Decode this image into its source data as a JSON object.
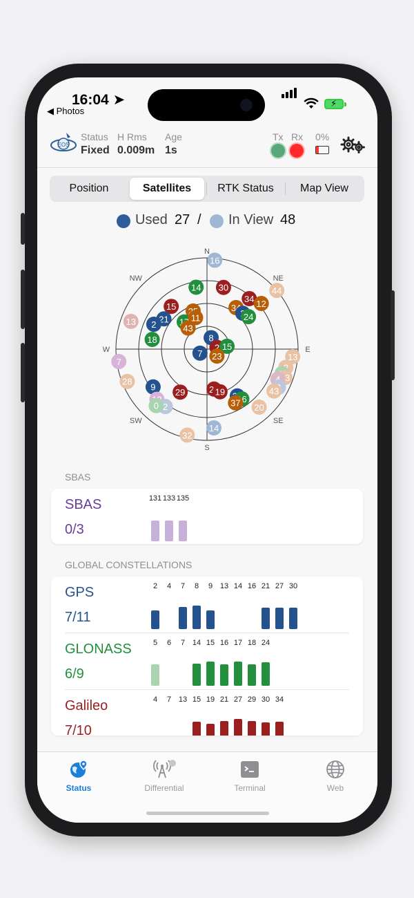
{
  "status_bar": {
    "time": "16:04",
    "back_label": "◀ Photos"
  },
  "header": {
    "status_label": "Status",
    "status_value": "Fixed",
    "hrms_label": "H Rms",
    "hrms_value": "0.009m",
    "age_label": "Age",
    "age_value": "1s",
    "tx_label": "Tx",
    "rx_label": "Rx",
    "battery_label": "0%",
    "logo_text": "EOS"
  },
  "tabs": [
    {
      "label": "Position",
      "active": false
    },
    {
      "label": "Satellites",
      "active": true
    },
    {
      "label": "RTK Status",
      "active": false
    },
    {
      "label": "Map View",
      "active": false
    }
  ],
  "legend": {
    "used_label": "Used",
    "used_count": "27",
    "sep": "/",
    "inview_label": "In View",
    "inview_count": "48"
  },
  "skyplot": {
    "directions": {
      "n": "N",
      "ne": "NE",
      "e": "E",
      "se": "SE",
      "s": "S",
      "sw": "SW",
      "w": "W",
      "nw": "NW"
    },
    "satellites": [
      {
        "prn": "16",
        "az": 5,
        "el": 2,
        "c": "#9fb6d4"
      },
      {
        "prn": "30",
        "az": 15,
        "el": 27,
        "c": "#9b1f1f"
      },
      {
        "prn": "14",
        "az": 350,
        "el": 28,
        "c": "#218f3c"
      },
      {
        "prn": "15",
        "az": 320,
        "el": 35,
        "c": "#9b1f1f"
      },
      {
        "prn": "34",
        "az": 40,
        "el": 25,
        "c": "#9b1f1f"
      },
      {
        "prn": "12",
        "az": 50,
        "el": 20,
        "c": "#b75e07"
      },
      {
        "prn": "44",
        "az": 50,
        "el": 0,
        "c": "#e9c2a5"
      },
      {
        "prn": "34",
        "az": 35,
        "el": 40,
        "c": "#b75e07"
      },
      {
        "prn": "2",
        "az": 45,
        "el": 40,
        "c": "#24528f"
      },
      {
        "prn": "24",
        "az": 52,
        "el": 38,
        "c": "#218f3c"
      },
      {
        "prn": "25",
        "az": 340,
        "el": 50,
        "c": "#b75e07"
      },
      {
        "prn": "21",
        "az": 305,
        "el": 38,
        "c": "#24528f"
      },
      {
        "prn": "17",
        "az": 320,
        "el": 55,
        "c": "#218f3c"
      },
      {
        "prn": "11",
        "az": 340,
        "el": 57,
        "c": "#b75e07"
      },
      {
        "prn": "43",
        "az": 318,
        "el": 62,
        "c": "#b75e07"
      },
      {
        "prn": "2",
        "az": 295,
        "el": 32,
        "c": "#24528f"
      },
      {
        "prn": "13",
        "az": 290,
        "el": 10,
        "c": "#e0b3b3"
      },
      {
        "prn": "18",
        "az": 280,
        "el": 35,
        "c": "#218f3c"
      },
      {
        "prn": "8",
        "az": 20,
        "el": 78,
        "c": "#24528f"
      },
      {
        "prn": "2",
        "az": 80,
        "el": 80,
        "c": "#9b1f1f"
      },
      {
        "prn": "15",
        "az": 82,
        "el": 70,
        "c": "#218f3c"
      },
      {
        "prn": "7",
        "az": 240,
        "el": 82,
        "c": "#24528f"
      },
      {
        "prn": "23",
        "az": 125,
        "el": 78,
        "c": "#b75e07"
      },
      {
        "prn": "13",
        "az": 95,
        "el": 5,
        "c": "#e9c2a5"
      },
      {
        "prn": "8",
        "az": 103,
        "el": 10,
        "c": "#e9c2a5"
      },
      {
        "prn": "7",
        "az": 108,
        "el": 12,
        "c": "#a8d4b0"
      },
      {
        "prn": "33",
        "az": 110,
        "el": 8,
        "c": "#e9c2a5"
      },
      {
        "prn": "4",
        "az": 113,
        "el": 14,
        "c": "#d9b8c8"
      },
      {
        "prn": "2",
        "az": 118,
        "el": 10,
        "c": "#b9c8dc"
      },
      {
        "prn": "43",
        "az": 122,
        "el": 12,
        "c": "#e9c2a5"
      },
      {
        "prn": "7",
        "az": 262,
        "el": 2,
        "c": "#d7b3d8"
      },
      {
        "prn": "28",
        "az": 248,
        "el": 5,
        "c": "#e9c2a5"
      },
      {
        "prn": "9",
        "az": 235,
        "el": 25,
        "c": "#24528f"
      },
      {
        "prn": "29",
        "az": 212,
        "el": 40,
        "c": "#9b1f1f"
      },
      {
        "prn": "13",
        "az": 225,
        "el": 20,
        "c": "#d7b3d8"
      },
      {
        "prn": "2",
        "az": 216,
        "el": 20,
        "c": "#b9c8dc"
      },
      {
        "prn": "0",
        "az": 222,
        "el": 15,
        "c": "#a8d4b0"
      },
      {
        "prn": "32",
        "az": 193,
        "el": 3,
        "c": "#e9c2a5"
      },
      {
        "prn": "14",
        "az": 175,
        "el": 12,
        "c": "#9fb6d4"
      },
      {
        "prn": "30",
        "az": 147,
        "el": 35,
        "c": "#24528f"
      },
      {
        "prn": "16",
        "az": 145,
        "el": 30,
        "c": "#218f3c"
      },
      {
        "prn": "21",
        "az": 170,
        "el": 50,
        "c": "#9b1f1f"
      },
      {
        "prn": "19",
        "az": 163,
        "el": 46,
        "c": "#9b1f1f"
      },
      {
        "prn": "37",
        "az": 152,
        "el": 30,
        "c": "#b75e07"
      },
      {
        "prn": "20",
        "az": 138,
        "el": 13,
        "c": "#e9c2a5"
      }
    ]
  },
  "sbas": {
    "section_title": "SBAS",
    "name": "SBAS",
    "count": "0/3",
    "color": "#6a3c97",
    "prns": [
      "131",
      "133",
      "135"
    ],
    "bars": [
      {
        "strength": 0.6,
        "used": false
      },
      {
        "strength": 0.6,
        "used": false
      },
      {
        "strength": 0.6,
        "used": false
      }
    ]
  },
  "global": {
    "section_title": "GLOBAL CONSTELLATIONS",
    "constellations": [
      {
        "name": "GPS",
        "count": "7/11",
        "color": "#24528f",
        "faded": "#a7bad2",
        "prns": [
          "2",
          "4",
          "7",
          "8",
          "9",
          "13",
          "14",
          "16",
          "21",
          "27",
          "30"
        ],
        "bars": [
          {
            "strength": 0.55,
            "used": true
          },
          {
            "strength": 0,
            "used": false
          },
          {
            "strength": 0.65,
            "used": true
          },
          {
            "strength": 0.68,
            "used": true
          },
          {
            "strength": 0.55,
            "used": true
          },
          {
            "strength": 0,
            "used": false
          },
          {
            "strength": 0,
            "used": false
          },
          {
            "strength": 0,
            "used": false
          },
          {
            "strength": 0.62,
            "used": true
          },
          {
            "strength": 0.62,
            "used": true
          },
          {
            "strength": 0.62,
            "used": true
          }
        ]
      },
      {
        "name": "GLONASS",
        "count": "6/9",
        "color": "#218f3c",
        "faded": "#a8d4b0",
        "prns": [
          "5",
          "6",
          "7",
          "14",
          "15",
          "16",
          "17",
          "18",
          "24"
        ],
        "bars": [
          {
            "strength": 0.62,
            "used": false
          },
          {
            "strength": 0,
            "used": false
          },
          {
            "strength": 0,
            "used": false
          },
          {
            "strength": 0.65,
            "used": true
          },
          {
            "strength": 0.7,
            "used": true
          },
          {
            "strength": 0.62,
            "used": true
          },
          {
            "strength": 0.7,
            "used": true
          },
          {
            "strength": 0.62,
            "used": true
          },
          {
            "strength": 0.68,
            "used": true
          }
        ]
      },
      {
        "name": "Galileo",
        "count": "7/10",
        "color": "#9b1f1f",
        "faded": "#dca5a5",
        "prns": [
          "4",
          "7",
          "13",
          "15",
          "19",
          "21",
          "27",
          "29",
          "30",
          "34"
        ],
        "bars": [
          {
            "strength": 0,
            "used": false
          },
          {
            "strength": 0,
            "used": false
          },
          {
            "strength": 0,
            "used": false
          },
          {
            "strength": 0.6,
            "used": true
          },
          {
            "strength": 0.55,
            "used": true
          },
          {
            "strength": 0.62,
            "used": true
          },
          {
            "strength": 0.68,
            "used": true
          },
          {
            "strength": 0.62,
            "used": true
          },
          {
            "strength": 0.58,
            "used": true
          },
          {
            "strength": 0.6,
            "used": true
          }
        ]
      }
    ]
  },
  "tabbar": [
    {
      "label": "Status",
      "icon": "globe-pin-icon",
      "active": true
    },
    {
      "label": "Differential",
      "icon": "antenna-icon",
      "active": false
    },
    {
      "label": "Terminal",
      "icon": "terminal-icon",
      "active": false
    },
    {
      "label": "Web",
      "icon": "globe-icon",
      "active": false
    }
  ],
  "colors": {
    "accent": "#1a80d9",
    "fixed_tx": "#5aa87a",
    "rx": "#ff2a2a"
  }
}
